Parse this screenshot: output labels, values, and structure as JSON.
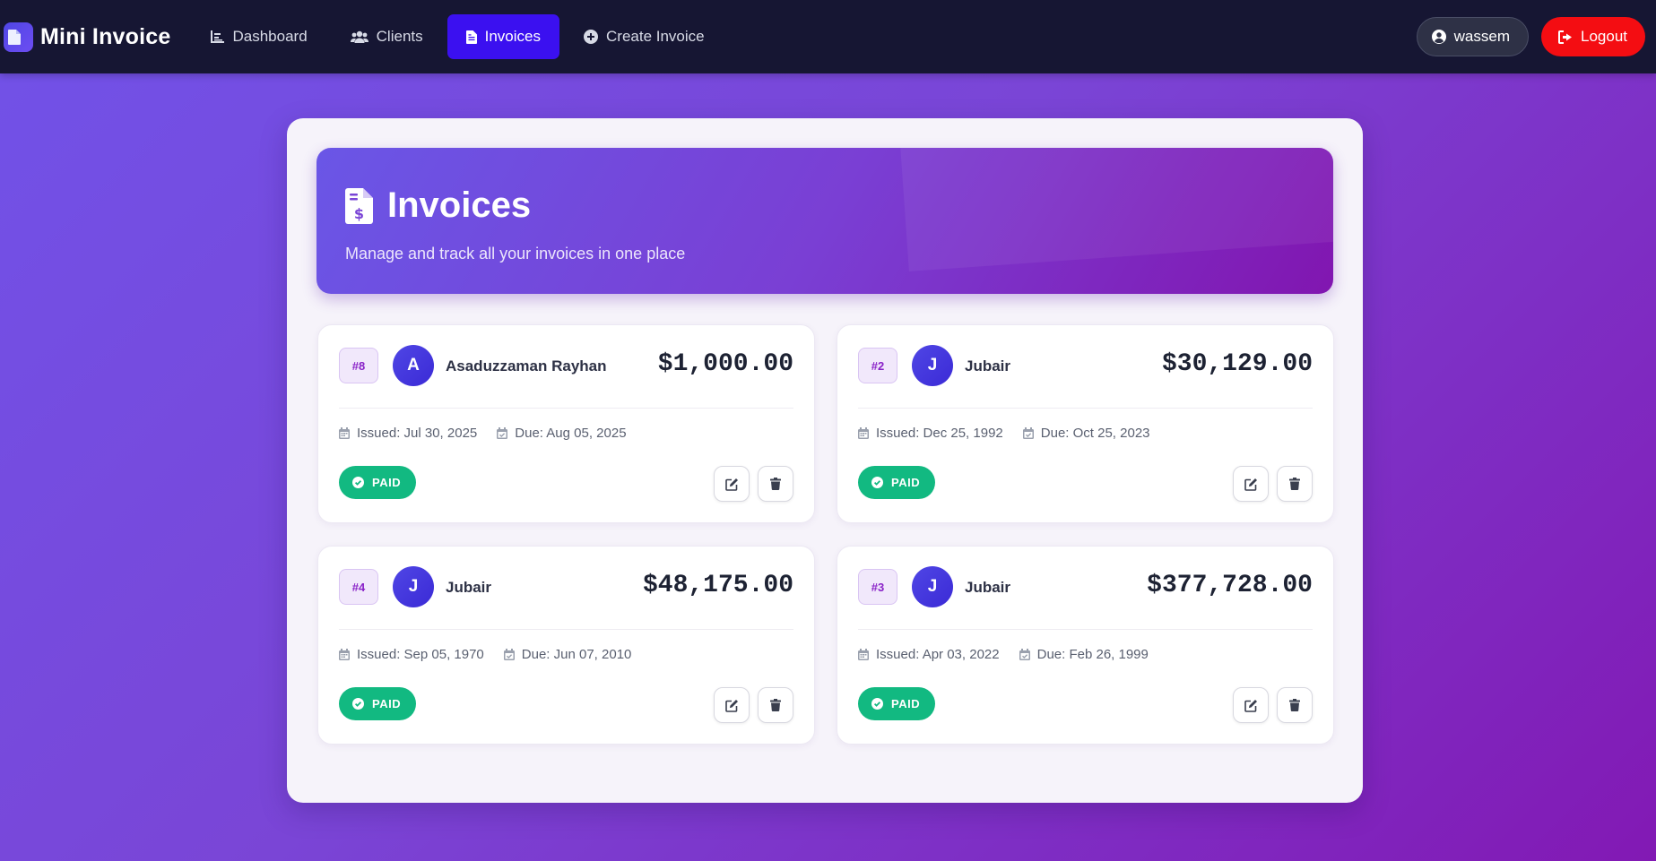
{
  "brand": {
    "title": "Mini Invoice",
    "icon": "document-icon"
  },
  "nav": {
    "links": [
      {
        "label": "Dashboard",
        "icon": "chart-icon",
        "active": false
      },
      {
        "label": "Clients",
        "icon": "users-icon",
        "active": false
      },
      {
        "label": "Invoices",
        "icon": "invoice-icon",
        "active": true
      },
      {
        "label": "Create Invoice",
        "icon": "plus-circle-icon",
        "active": false
      }
    ],
    "user": {
      "name": "wassem",
      "icon": "user-circle-icon"
    },
    "logout": {
      "label": "Logout",
      "icon": "logout-icon"
    }
  },
  "hero": {
    "title": "Invoices",
    "subtitle": "Manage and track all your invoices in one place",
    "icon": "invoice-dollar-icon"
  },
  "invoices": [
    {
      "number": "#8",
      "initial": "A",
      "client": "Asaduzzaman Rayhan",
      "amount": "$1,000.00",
      "issued": "Issued: Jul 30, 2025",
      "due": "Due: Aug 05, 2025",
      "status": "PAID"
    },
    {
      "number": "#2",
      "initial": "J",
      "client": "Jubair",
      "amount": "$30,129.00",
      "issued": "Issued: Dec 25, 1992",
      "due": "Due: Oct 25, 2023",
      "status": "PAID"
    },
    {
      "number": "#4",
      "initial": "J",
      "client": "Jubair",
      "amount": "$48,175.00",
      "issued": "Issued: Sep 05, 1970",
      "due": "Due: Jun 07, 2010",
      "status": "PAID"
    },
    {
      "number": "#3",
      "initial": "J",
      "client": "Jubair",
      "amount": "$377,728.00",
      "issued": "Issued: Apr 03, 2022",
      "due": "Due: Feb 26, 1999",
      "status": "PAID"
    }
  ],
  "colors": {
    "navbar": "#161633",
    "active_nav": "#3b10f0",
    "logout": "#f40d12",
    "paid": "#12b981",
    "accent_purple": "#8a23c8"
  }
}
